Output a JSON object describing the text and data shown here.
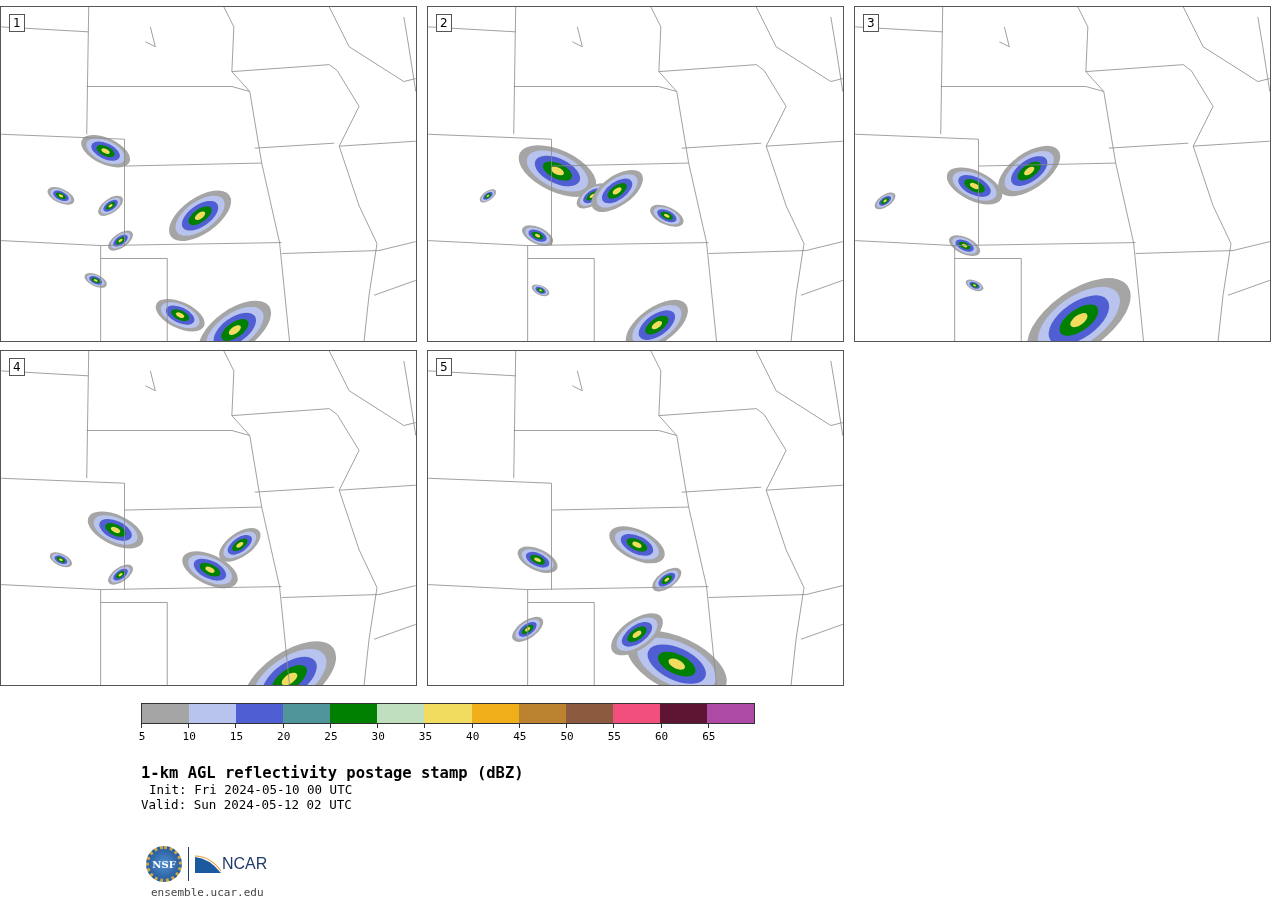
{
  "panels": [
    {
      "label": "1"
    },
    {
      "label": "2"
    },
    {
      "label": "3"
    },
    {
      "label": "4"
    },
    {
      "label": "5"
    }
  ],
  "colorbar": {
    "bins": [
      {
        "color": "#a5a5a5",
        "tick": "5"
      },
      {
        "color": "#b8c3ee",
        "tick": "10"
      },
      {
        "color": "#505ed4",
        "tick": "15"
      },
      {
        "color": "#4f9599",
        "tick": "20"
      },
      {
        "color": "#008000",
        "tick": "25"
      },
      {
        "color": "#bfdfbf",
        "tick": "30"
      },
      {
        "color": "#f1dc5f",
        "tick": "35"
      },
      {
        "color": "#f0ae1a",
        "tick": "40"
      },
      {
        "color": "#bb822f",
        "tick": "45"
      },
      {
        "color": "#8b5a3f",
        "tick": "50"
      },
      {
        "color": "#f34f7d",
        "tick": "55"
      },
      {
        "color": "#5e1533",
        "tick": "60"
      },
      {
        "color": "#ac4aa5",
        "tick": "65"
      }
    ]
  },
  "title": "1-km AGL reflectivity postage stamp (dBZ)",
  "init": "Init: Fri 2024-05-10 00 UTC",
  "valid": "Valid: Sun 2024-05-12 02 UTC",
  "logos": {
    "nsf": "NSF",
    "ncar": "NCAR"
  },
  "url": "ensemble.ucar.edu"
}
